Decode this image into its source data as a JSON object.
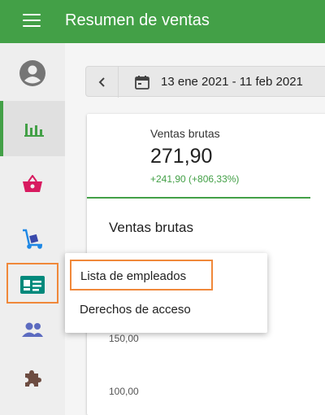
{
  "app": {
    "title": "Resumen de ventas",
    "accent_color": "#43a047",
    "highlight_color": "#f0883a"
  },
  "sidebar": {
    "items": [
      {
        "name": "account-icon",
        "active": false
      },
      {
        "name": "bar-chart-icon",
        "active": true
      },
      {
        "name": "basket-icon",
        "active": false
      },
      {
        "name": "hand-truck-icon",
        "active": false
      },
      {
        "name": "id-card-icon",
        "active": false,
        "highlighted": true
      },
      {
        "name": "people-icon",
        "active": false
      },
      {
        "name": "puzzle-icon",
        "active": false
      }
    ]
  },
  "date_filter": {
    "range": "13 ene 2021 - 11 feb 2021",
    "prev_icon": "chevron-left-icon",
    "calendar_icon": "calendar-icon"
  },
  "metric": {
    "label": "Ventas brutas",
    "value": "271,90",
    "delta": "+241,90 (+806,33%)"
  },
  "chart": {
    "title": "Ventas brutas",
    "ticks": [
      "150,00",
      "100,00"
    ]
  },
  "popup_menu": {
    "items": [
      {
        "label": "Lista de empleados",
        "highlighted": true
      },
      {
        "label": "Derechos de acceso"
      }
    ]
  }
}
